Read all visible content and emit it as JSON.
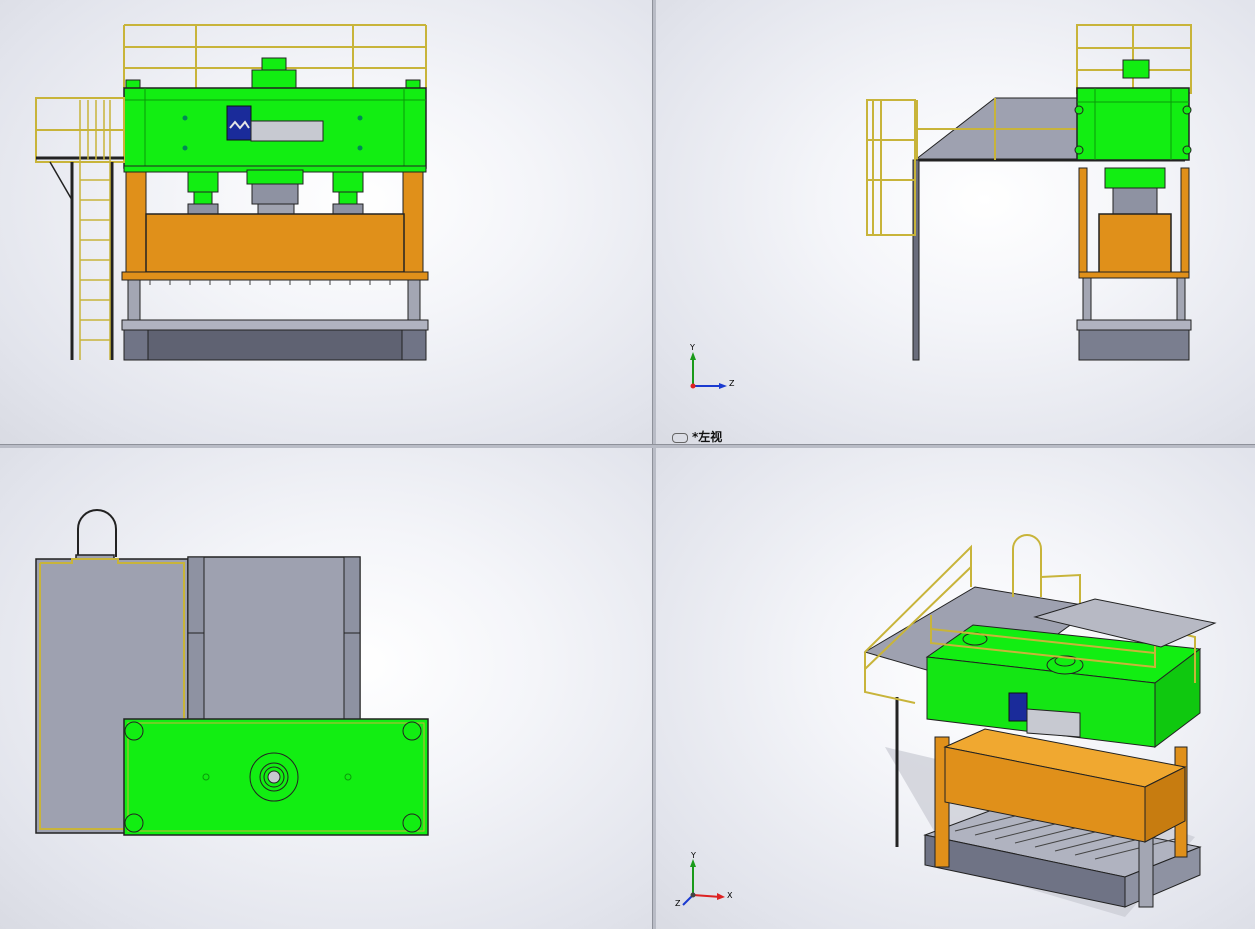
{
  "viewports": {
    "front": {
      "name": "front-view"
    },
    "left": {
      "name": "left-view",
      "label": "*左视",
      "axis_y": "Y",
      "axis_z": "Z"
    },
    "top": {
      "name": "top-view"
    },
    "iso": {
      "name": "isometric-view",
      "axis_y": "Y",
      "axis_z": "Z",
      "axis_x": "X"
    }
  },
  "colors": {
    "machine_green": "#12ee12",
    "column_orange": "#e0901a",
    "base_gray": "#8e92a2",
    "railing_yellow": "#d8c84a",
    "logo_blue": "#1a2b9a"
  }
}
